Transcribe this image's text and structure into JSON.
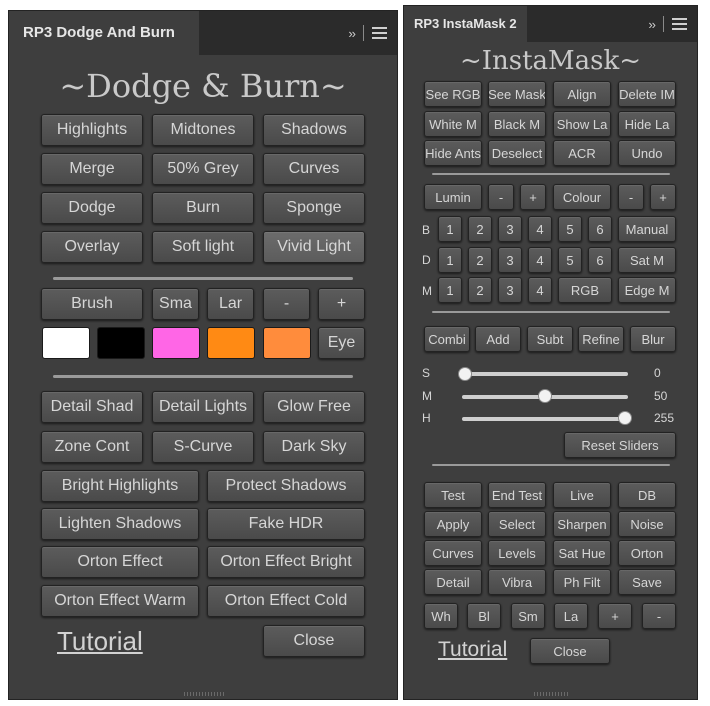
{
  "left_panel": {
    "tab_title": "RP3 Dodge And Burn",
    "heading": "~Dodge & Burn~",
    "row1": [
      "Highlights",
      "Midtones",
      "Shadows"
    ],
    "row2": [
      "Merge",
      "50% Grey",
      "Curves"
    ],
    "row3": [
      "Dodge",
      "Burn",
      "Sponge"
    ],
    "row4": [
      "Overlay",
      "Soft light",
      "Vivid Light"
    ],
    "brush_row": [
      "Brush",
      "Sma",
      "Lar",
      "-",
      "+"
    ],
    "swatch_colors": [
      "#ffffff",
      "#000000",
      "#ff66e6",
      "#ff8a14",
      "#ff8c3c"
    ],
    "eye_label": "Eye",
    "row5": [
      "Detail Shad",
      "Detail Lights",
      "Glow Free"
    ],
    "row6": [
      "Zone Cont",
      "S-Curve",
      "Dark Sky"
    ],
    "row7": [
      "Bright Highlights",
      "Protect Shadows"
    ],
    "row8": [
      "Lighten Shadows",
      "Fake HDR"
    ],
    "row9": [
      "Orton Effect",
      "Orton Effect Bright"
    ],
    "row10": [
      "Orton Effect Warm",
      "Orton Effect Cold"
    ],
    "tutorial": "Tutorial",
    "close": "Close"
  },
  "right_panel": {
    "tab_title": "RP3 InstaMask 2",
    "heading": "~InstaMask~",
    "row1": [
      "See RGB",
      "See Mask",
      "Align",
      "Delete IM"
    ],
    "row2": [
      "White M",
      "Black M",
      "Show La",
      "Hide La"
    ],
    "row3": [
      "Hide Ants",
      "Deselect",
      "ACR",
      "Undo"
    ],
    "lumin_row": [
      "Lumin",
      "-",
      "+",
      "Colour",
      "-",
      "+"
    ],
    "b_label": "B",
    "b_row": [
      "1",
      "2",
      "3",
      "4",
      "5",
      "6",
      "Manual"
    ],
    "d_label": "D",
    "d_row": [
      "1",
      "2",
      "3",
      "4",
      "5",
      "6",
      "Sat M"
    ],
    "m_label": "M",
    "m_row": [
      "1",
      "2",
      "3",
      "4",
      "RGB",
      "Edge M"
    ],
    "combi_row": [
      "Combi",
      "Add",
      "Subt",
      "Refine",
      "Blur"
    ],
    "sliders": [
      {
        "label": "S",
        "value": "0",
        "fraction": 0.0
      },
      {
        "label": "M",
        "value": "50",
        "fraction": 0.5
      },
      {
        "label": "H",
        "value": "255",
        "fraction": 1.0
      }
    ],
    "reset_sliders": "Reset Sliders",
    "row4": [
      "Test",
      "End Test",
      "Live",
      "DB"
    ],
    "row5": [
      "Apply",
      "Select",
      "Sharpen",
      "Noise"
    ],
    "row6": [
      "Curves",
      "Levels",
      "Sat Hue",
      "Orton"
    ],
    "row7": [
      "Detail",
      "Vibra",
      "Ph Filt",
      "Save"
    ],
    "row8": [
      "Wh",
      "Bl",
      "Sm",
      "La",
      "+",
      "-"
    ],
    "tutorial": "Tutorial",
    "close": "Close"
  }
}
